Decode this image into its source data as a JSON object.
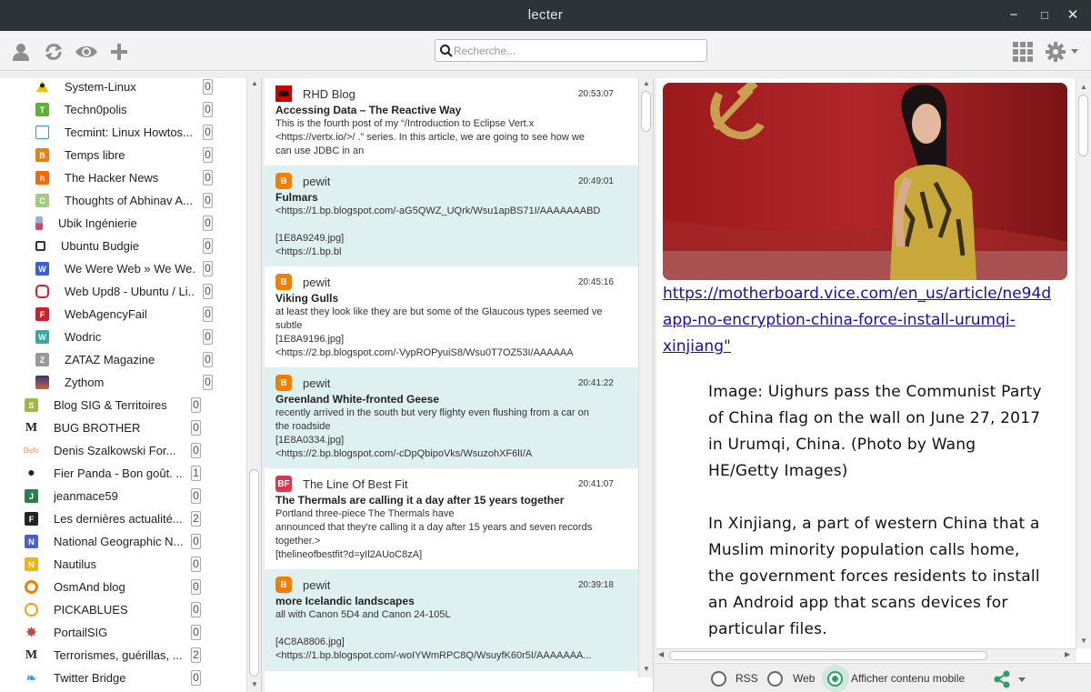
{
  "window": {
    "title": "lecter",
    "minimize": "−",
    "maximize": "□",
    "close": "✕"
  },
  "toolbar": {
    "icons": [
      "user-icon",
      "refresh-icon",
      "eye-icon",
      "add-icon",
      "grid-icon",
      "gear-icon"
    ],
    "search_placeholder": "Recherche..."
  },
  "feeds": [
    {
      "label": "System-Linux",
      "count": "0",
      "icon": "linux-icon",
      "color": "#f2c200"
    },
    {
      "label": "Techn0polis",
      "count": "0",
      "icon": "t-icon",
      "color": "#5bb52d",
      "letter": "T"
    },
    {
      "label": "Tecmint: Linux Howtos...",
      "count": "0",
      "icon": "tecmint-icon",
      "color": "#3a8fd6"
    },
    {
      "label": "Temps libre",
      "count": "0",
      "icon": "blogger-icon",
      "color": "#f57d00",
      "letter": "B"
    },
    {
      "label": "The Hacker News",
      "count": "0",
      "icon": "hackernews-icon",
      "color": "#ff6600",
      "letter": "h"
    },
    {
      "label": "Thoughts of Abhinav A...",
      "count": "0",
      "icon": "c-icon",
      "color": "#9fcf7c",
      "letter": "C"
    },
    {
      "label": "Ubik Ingénierie",
      "count": "0",
      "icon": "ubik-icon",
      "color": "#c94a6a"
    },
    {
      "label": "Ubuntu Budgie",
      "count": "0",
      "icon": "budgie-icon",
      "color": "#333333"
    },
    {
      "label": "We Were Web » We We...",
      "count": "0",
      "icon": "w-icon",
      "color": "#3a5ed6",
      "letter": "W"
    },
    {
      "label": "Web Upd8 - Ubuntu / Li...",
      "count": "0",
      "icon": "webupd8-icon",
      "color": "#d0212b"
    },
    {
      "label": "WebAgencyFail",
      "count": "0",
      "icon": "webagencyfail-icon",
      "color": "#d0212b",
      "letter": "F"
    },
    {
      "label": "Wodric",
      "count": "0",
      "icon": "wodric-icon",
      "color": "#35a8a0",
      "letter": "W"
    },
    {
      "label": "ZATAZ Magazine",
      "count": "0",
      "icon": "z-icon",
      "color": "#999999",
      "letter": "Z"
    },
    {
      "label": "Zythom",
      "count": "0",
      "icon": "zythom-icon",
      "color": "#7a3a7a"
    },
    {
      "label": "Blog SIG & Territoires",
      "count": "0",
      "icon": "s-icon",
      "color": "#9cb84a",
      "letter": "S"
    },
    {
      "label": "BUG BROTHER",
      "count": "0",
      "icon": "lemonde-icon",
      "color": "#222222",
      "letter": "M"
    },
    {
      "label": "Denis Szalkowski For...",
      "count": "0",
      "icon": "dsfc-icon",
      "color": "#f0a860"
    },
    {
      "label": "Fier Panda - Bon goût. ...",
      "count": "1",
      "icon": "panda-icon",
      "color": "#222222"
    },
    {
      "label": "jeanmace59",
      "count": "0",
      "icon": "j-icon",
      "color": "#2e7d4f",
      "letter": "J"
    },
    {
      "label": "Les dernières actualité...",
      "count": "2",
      "icon": "f-icon",
      "color": "#222222",
      "letter": "F"
    },
    {
      "label": "National Geographic N...",
      "count": "0",
      "icon": "n-icon",
      "color": "#4a5fd0",
      "letter": "N"
    },
    {
      "label": "Nautilus",
      "count": "0",
      "icon": "nautilus-icon",
      "color": "#f2b400",
      "letter": "N"
    },
    {
      "label": "OsmAnd blog",
      "count": "0",
      "icon": "osmand-icon",
      "color": "#f57d00"
    },
    {
      "label": "PICKABLUES",
      "count": "0",
      "icon": "pickablues-icon",
      "color": "#e8a020"
    },
    {
      "label": "PortailSIG",
      "count": "0",
      "icon": "portailsig-icon",
      "color": "#c04848"
    },
    {
      "label": "Terrorismes, guérillas, ...",
      "count": "2",
      "icon": "lemonde-icon",
      "color": "#222222",
      "letter": "M"
    },
    {
      "label": "Twitter Bridge",
      "count": "0",
      "icon": "twitter-icon",
      "color": "#1da1f2"
    }
  ],
  "articles": [
    {
      "source": "RHD Blog",
      "time": "20:53:07",
      "title": "Accessing Data – The Reactive Way",
      "body": "This is the fourth post of my “/Introduction to Eclipse Vert.x\n<https://vertx.io/>/ .” series. In this article, we are going to see how we\ncan use JDBC in an",
      "icon": "redhat-icon",
      "color": "#cc0000",
      "letter": ""
    },
    {
      "source": "pewit",
      "time": "20:49:01",
      "title": "Fulmars",
      "body": "<https://1.bp.blogspot.com/-aG5QWZ_UQrk/Wsu1apBS71I/AAAAAAABD\n\n[1E8A9249.jpg]\n<https://1.bp.bl",
      "icon": "blogger-icon",
      "color": "#f57d00",
      "letter": "B"
    },
    {
      "source": "pewit",
      "time": "20:45:16",
      "title": "Viking Gulls",
      "body": "at least they look like they are but some of the Glaucous types seemed ve\nsubtle\n[1E8A9196.jpg]\n<https://2.bp.blogspot.com/-VypROPyuiS8/Wsu0T7OZ53I/AAAAAA",
      "icon": "blogger-icon",
      "color": "#f57d00",
      "letter": "B"
    },
    {
      "source": "pewit",
      "time": "20:41:22",
      "title": "Greenland White-fronted Geese",
      "body": "recently arrived in the south but very flighty even flushing from a car on\nthe roadside\n[1E8A0334.jpg]\n<https://2.bp.blogspot.com/-cDpQbipoVks/WsuzohXF6lI/A",
      "icon": "blogger-icon",
      "color": "#f57d00",
      "letter": "B"
    },
    {
      "source": "The Line Of Best Fit",
      "time": "20:41:07",
      "title": "The Thermals are calling it a day after 15 years together",
      "body": "Portland three-piece The Thermals have\nannounced that they're calling it a day after 15 years and seven records\ntogether.>\n[thelineofbestfit?d=yIl2AUoC8zA]",
      "icon": "bestfit-icon",
      "color": "#e8304a",
      "letter": "BF"
    },
    {
      "source": "pewit",
      "time": "20:39:18",
      "title": "more Icelandic landscapes",
      "body": "all with Canon 5D4 and Canon 24-105L\n\n[4C8A8806.jpg]\n<https://1.bp.blogspot.com/-woIYWmRPC8Q/WsuyfK60r5I/AAAAAAA...",
      "icon": "blogger-icon",
      "color": "#f57d00",
      "letter": "B"
    }
  ],
  "content": {
    "link": "https://motherboard.vice.com/en_us/article/ne94d\napp-no-encryption-china-force-install-urumqi-\nxinjiang",
    "link_l1": "https://motherboard.vice.com/en_us/article/ne94d",
    "link_l2": "app-no-encryption-china-force-install-urumqi-",
    "link_l3": "xinjiang",
    "quote": "\"",
    "caption": "Image: Uighurs pass the Communist Party of China flag on the wall on June 27, 2017 in Urumqi, China. (Photo by Wang HE/Getty Images)",
    "paragraph": "In Xinjiang, a part of western China that a Muslim minority population calls home, the government forces residents to install an Android app that scans devices for particular files."
  },
  "bottombar": {
    "rss_label": "RSS",
    "web_label": "Web",
    "mobile_label": "Afficher contenu mobile",
    "selected": "mobile",
    "share_icon": "share-icon"
  }
}
